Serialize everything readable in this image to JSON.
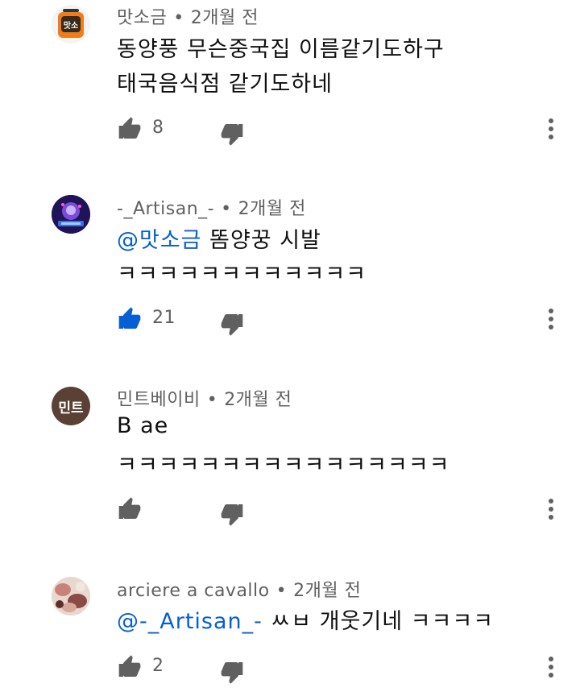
{
  "colors": {
    "text": "#0f0f0f",
    "meta": "#606060",
    "mention": "#065fd4",
    "like_active": "#065fd4",
    "icon": "#606060"
  },
  "separator": "•",
  "comments": [
    {
      "author": "맛소금",
      "time": "2개월 전",
      "avatar_icon": "channel-avatar-salt",
      "lines": [
        "동양풍 무슨중국집 이름같기도하구",
        "태국음식점 같기도하네"
      ],
      "likes": "8",
      "liked": false
    },
    {
      "author": "-_Artisan_-",
      "time": "2개월 전",
      "avatar_icon": "channel-avatar-artisan",
      "mention": "@맛소금",
      "lines": [
        " 똠양꿍 시발",
        "ㅋㅋㅋㅋㅋㅋㅋㅋㅋㅋㅋㅋ"
      ],
      "likes": "21",
      "liked": true
    },
    {
      "author": "민트베이비",
      "time": "2개월 전",
      "avatar_text": "민트",
      "lines": [
        "B ae",
        "ㅋㅋㅋㅋㅋㅋㅋㅋㅋㅋㅋㅋㅋㅋㅋㅋ"
      ],
      "likes": "",
      "liked": false
    },
    {
      "author": "arciere a cavallo",
      "time": "2개월 전",
      "avatar_icon": "channel-avatar-arciere",
      "mention": "@-_Artisan_-",
      "lines": [
        " ㅆㅂ 개웃기네 ㅋㅋㅋㅋ"
      ],
      "likes": "2",
      "liked": false
    }
  ]
}
